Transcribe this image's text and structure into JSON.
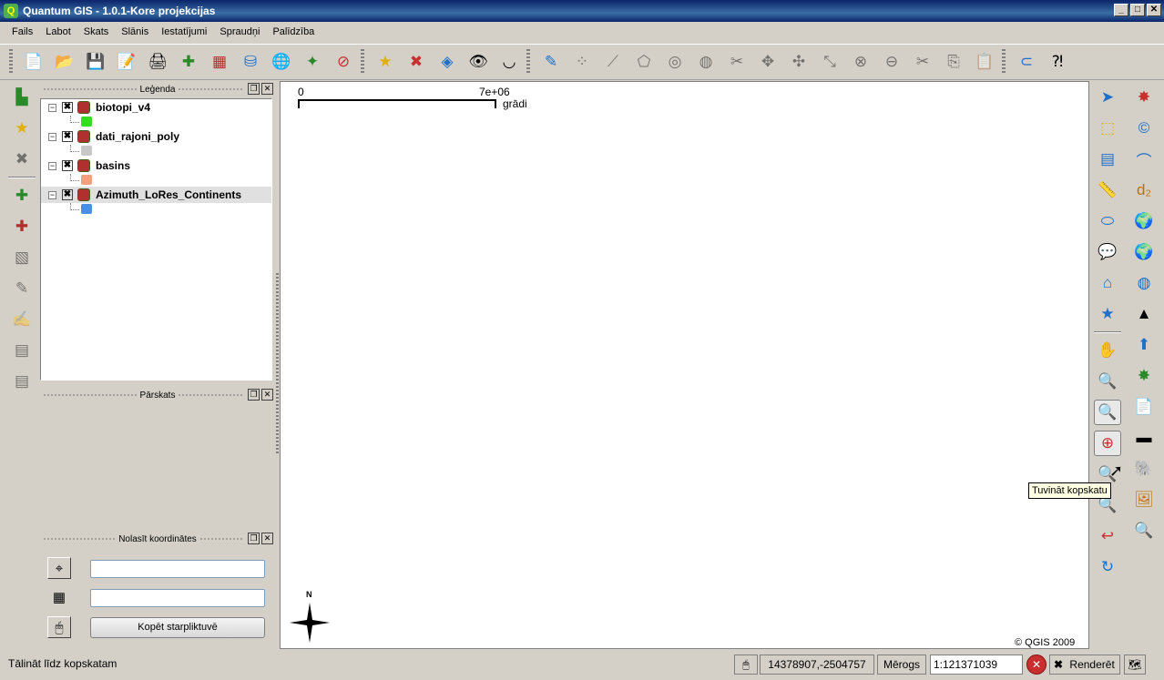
{
  "window": {
    "title": "Quantum GIS - 1.0.1-Kore  projekcijas",
    "min": "_",
    "max": "□",
    "close": "✕"
  },
  "menu": [
    "Fails",
    "Labot",
    "Skats",
    "Slānis",
    "Iestatījumi",
    "Spraudņi",
    "Palīdzība"
  ],
  "legend_panel": {
    "title": "Leģenda",
    "layers": [
      {
        "name": "biotopi_v4",
        "checked": "✖",
        "symbol_color": "#33dd22"
      },
      {
        "name": "dati_rajoni_poly",
        "checked": "✖",
        "symbol_color": "#c8c8c8"
      },
      {
        "name": "basins",
        "checked": "✖",
        "symbol_color": "#f0a080"
      },
      {
        "name": "Azimuth_LoRes_Continents",
        "checked": "✖",
        "symbol_color": "#4a90e2"
      }
    ]
  },
  "overview_panel": {
    "title": "Pārskats"
  },
  "coords_panel": {
    "title": "Nolasīt koordinātes",
    "copy_button": "Kopēt starpliktuvē"
  },
  "map": {
    "scalebar": {
      "left_label": "0",
      "right_label": "7e+06",
      "unit": "grādi"
    },
    "north_label": "N",
    "copyright": "© QGIS 2009"
  },
  "tooltip": "Tuvināt kopskatu",
  "status": {
    "message": "Tālināt līdz kopskatam",
    "coordinates": "14378907,-2504757",
    "scale_label": "Mērogs",
    "scale_value": "1:121371039",
    "render_checked": "✖",
    "render_label": "Renderēt"
  },
  "colors": {
    "titlebar": "#0a246a",
    "chrome": "#d4d0c8"
  }
}
